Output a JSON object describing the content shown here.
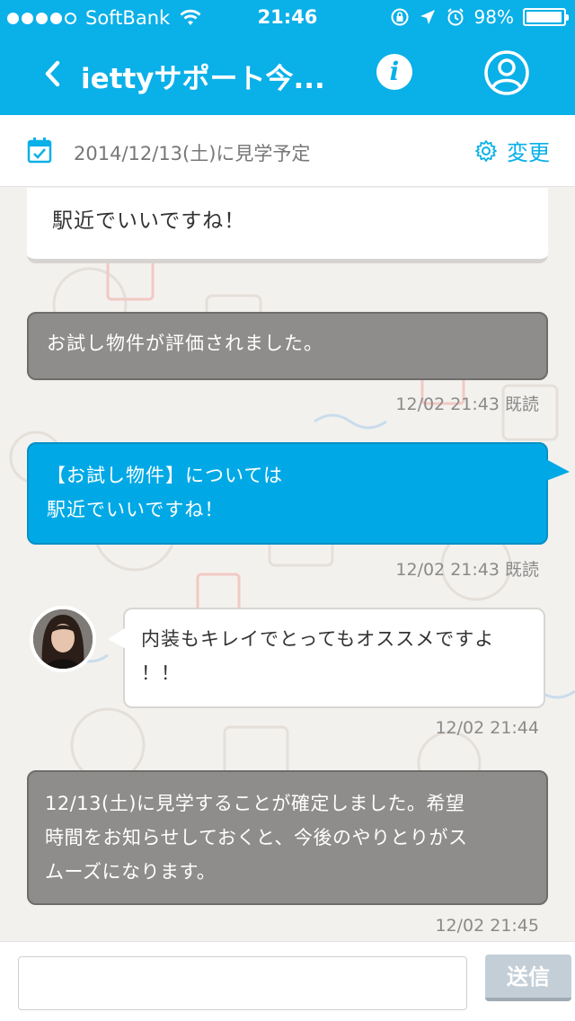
{
  "status_bar": {
    "carrier": "SoftBank",
    "time": "21:46",
    "battery": "98%",
    "battery_level": 0.98,
    "signal_bars": 4,
    "icons": [
      "wifi-icon",
      "lock-rotation-icon",
      "location-icon",
      "alarm-icon"
    ]
  },
  "nav": {
    "title": "iettyサポート今...",
    "icons": [
      "back-icon",
      "info-icon",
      "profile-icon"
    ]
  },
  "visit": {
    "date_text": "2014/12/13(土)に見学予定",
    "change_label": "変更"
  },
  "messages": [
    {
      "id": "m0",
      "style": "white",
      "lines": [
        "駅近でいいですね！"
      ]
    },
    {
      "id": "m1",
      "style": "gray",
      "lines": [
        "お試し物件が評価されました。"
      ],
      "time": "12/02 21:43 既読"
    },
    {
      "id": "m2",
      "style": "blue",
      "lines": [
        "【お試し物件】については",
        "駅近でいいですね！"
      ],
      "time": "12/02 21:43 既読"
    },
    {
      "id": "m3",
      "style": "white",
      "lines": [
        "内装もキレイでとってもオススメですよ",
        "！！"
      ],
      "time": "12/02 21:44"
    },
    {
      "id": "m4",
      "style": "gray",
      "lines": [
        "12/13(土)に見学することが確定しました。希望",
        "時間をお知らせしておくと、今後のやりとりがス",
        "ムーズになります。"
      ],
      "time": "12/02 21:45"
    }
  ],
  "composer": {
    "placeholder": "",
    "send_label": "送信"
  },
  "colors": {
    "brand": "#0ab0e8",
    "bubble_blue": "#00a9e6",
    "bubble_gray": "#8f8d8b",
    "send_button": "#c4ced6"
  }
}
